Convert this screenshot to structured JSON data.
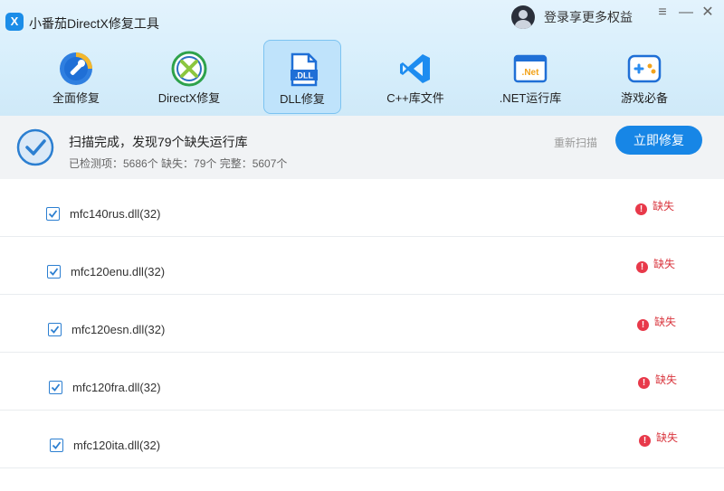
{
  "app": {
    "title": "小番茄DirectX修复工具",
    "logo_glyph": "X"
  },
  "user": {
    "login_label": "登录享更多权益"
  },
  "window": {
    "menu": "≡",
    "minimize": "—",
    "close": "✕"
  },
  "tabs": [
    {
      "label": "全面修复",
      "icon": "wrench-icon"
    },
    {
      "label": "DirectX修复",
      "icon": "directx-icon"
    },
    {
      "label": "DLL修复",
      "icon": "dll-file-icon",
      "active": true
    },
    {
      "label": "C++库文件",
      "icon": "visual-studio-icon"
    },
    {
      "label": ".NET运行库",
      "icon": "dotnet-icon"
    },
    {
      "label": "游戏必备",
      "icon": "gamepad-icon"
    }
  ],
  "tab_icon_text": {
    "dll": ".DLL",
    "net": ".Net"
  },
  "scan": {
    "title": "扫描完成，发现79个缺失运行库",
    "stats": "已检测项：5686个 缺失：79个 完整：5607个",
    "rescan_label": "重新扫描",
    "fix_label": "立即修复"
  },
  "items": [
    {
      "name": "mfc140rus.dll(32)",
      "status": "缺失",
      "checked": true
    },
    {
      "name": "mfc120enu.dll(32)",
      "status": "缺失",
      "checked": true
    },
    {
      "name": "mfc120esn.dll(32)",
      "status": "缺失",
      "checked": true
    },
    {
      "name": "mfc120fra.dll(32)",
      "status": "缺失",
      "checked": true
    },
    {
      "name": "mfc120ita.dll(32)",
      "status": "缺失",
      "checked": true
    }
  ],
  "colors": {
    "accent": "#1786e6",
    "missing": "#d9363e",
    "header_bg": "#d6eefb"
  }
}
